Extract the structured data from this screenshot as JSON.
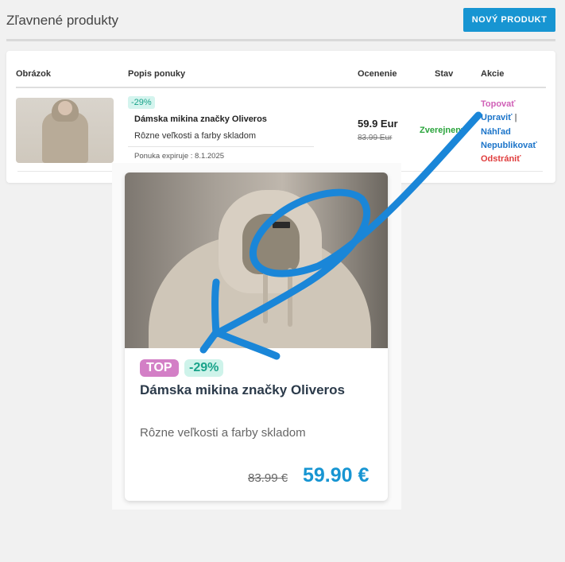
{
  "header": {
    "title": "Zľavnené produkty",
    "new_button": "NOVÝ PRODUKT"
  },
  "table": {
    "columns": [
      "Obrázok",
      "Popis ponuky",
      "Ocenenie",
      "Stav",
      "Akcie"
    ],
    "row": {
      "discount": "-29%",
      "name": "Dámska mikina značky Oliveros",
      "description": "Rôzne veľkosti a farby skladom",
      "expiry": "Ponuka expiruje : 8.1.2025",
      "price": "59.9 Eur",
      "old_price": "83.99 Eur",
      "status": "Zverejnený",
      "actions": {
        "top": "Topovať",
        "edit": "Upraviť",
        "sep": "|",
        "preview": "Náhľad",
        "unpublish": "Nepublikovať",
        "delete": "Odstrániť"
      }
    }
  },
  "preview": {
    "tag_top": "TOP",
    "discount": "-29%",
    "name": "Dámska mikina značky Oliveros",
    "description": "Rôzne veľkosti a farby skladom",
    "old_price": "83.99 €",
    "price": "59.90 €"
  },
  "colors": {
    "accent": "#1795d2",
    "top_tag": "#d37fc6",
    "discount": "#19a38a",
    "status": "#2aa43c",
    "delete": "#e03d3d"
  }
}
